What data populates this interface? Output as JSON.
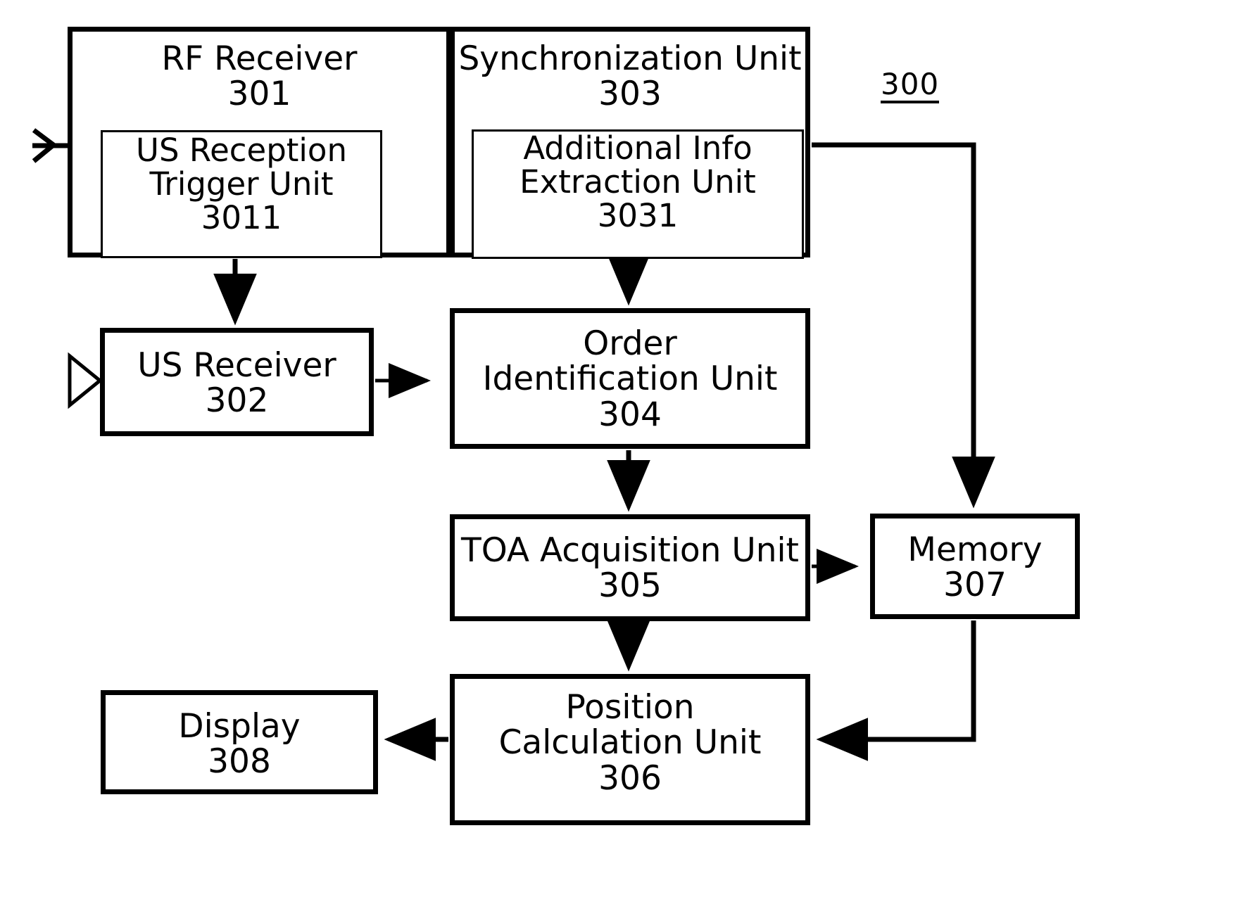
{
  "figure": {
    "reference_numeral": "300",
    "type": "block-diagram",
    "description": "Positioning receiver apparatus block diagram"
  },
  "blocks": {
    "rf_receiver": {
      "name": "RF Receiver",
      "numeral": "301",
      "lines": [
        "RF Receiver",
        "301"
      ]
    },
    "us_reception_trigger": {
      "name": "US Reception Trigger Unit",
      "numeral": "3011",
      "lines": [
        "US Reception",
        "Trigger Unit",
        "3011"
      ]
    },
    "synchronization_unit": {
      "name": "Synchronization Unit",
      "numeral": "303",
      "lines": [
        "Synchronization Unit",
        "303"
      ]
    },
    "additional_info_extraction": {
      "name": "Additional Info Extraction Unit",
      "numeral": "3031",
      "lines": [
        "Additional Info",
        "Extraction Unit",
        "3031"
      ]
    },
    "us_receiver": {
      "name": "US Receiver",
      "numeral": "302",
      "lines": [
        "US Receiver",
        "302"
      ]
    },
    "order_identification_unit": {
      "name": "Order Identification Unit",
      "numeral": "304",
      "lines": [
        "Order",
        "Identification Unit",
        "304"
      ]
    },
    "toa_acquisition_unit": {
      "name": "TOA Acquisition Unit",
      "numeral": "305",
      "lines": [
        "TOA Acquisition Unit",
        "305"
      ]
    },
    "memory": {
      "name": "Memory",
      "numeral": "307",
      "lines": [
        "Memory",
        "307"
      ]
    },
    "position_calculation_unit": {
      "name": "Position Calculation Unit",
      "numeral": "306",
      "lines": [
        "Position",
        "Calculation Unit",
        "306"
      ]
    },
    "display": {
      "name": "Display",
      "numeral": "308",
      "lines": [
        "Display",
        "308"
      ]
    }
  },
  "icons": {
    "rf_antenna": "antenna-icon",
    "us_transducer": "ultrasonic-transducer-icon"
  },
  "connections": [
    {
      "from": "rf_receiver",
      "to": "synchronization_unit",
      "direction": "right"
    },
    {
      "from": "us_reception_trigger",
      "to": "us_receiver",
      "direction": "down"
    },
    {
      "from": "synchronization_unit",
      "to": "order_identification_unit",
      "direction": "down"
    },
    {
      "from": "us_receiver",
      "to": "order_identification_unit",
      "direction": "right"
    },
    {
      "from": "order_identification_unit",
      "to": "toa_acquisition_unit",
      "direction": "down"
    },
    {
      "from": "toa_acquisition_unit",
      "to": "memory",
      "direction": "right"
    },
    {
      "from": "toa_acquisition_unit",
      "to": "position_calculation_unit",
      "direction": "down"
    },
    {
      "from": "synchronization_unit",
      "to": "memory",
      "direction": "right-down"
    },
    {
      "from": "memory",
      "to": "position_calculation_unit",
      "direction": "down-left"
    },
    {
      "from": "position_calculation_unit",
      "to": "display",
      "direction": "left"
    }
  ],
  "style": {
    "stroke": "#000000",
    "background": "#ffffff"
  }
}
